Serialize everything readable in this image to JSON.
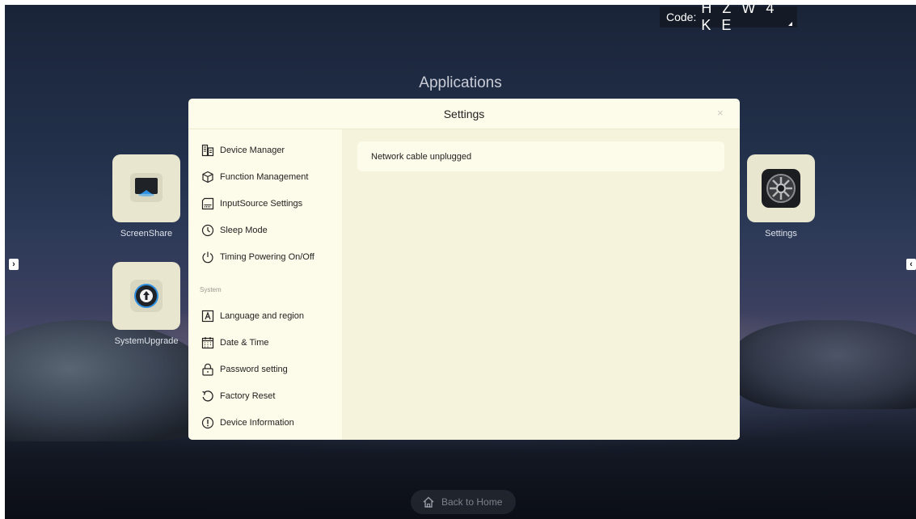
{
  "code": {
    "label": "Code:",
    "value": "H Z W 4 K E"
  },
  "applications_title": "Applications",
  "apps": [
    {
      "label": "ScreenShare",
      "icon": "screenshare-icon"
    },
    {
      "label": "SystemUpgrade",
      "icon": "system-upgrade-icon"
    },
    {
      "label": "Settings",
      "icon": "settings-app-icon"
    }
  ],
  "nav_arrows": {
    "left": "›",
    "right": "‹"
  },
  "back_home": {
    "label": "Back to Home",
    "icon": "home-icon"
  },
  "dialog": {
    "title": "Settings",
    "close": "×",
    "menu": [
      {
        "label": "Device Manager",
        "icon": "device-manager-icon"
      },
      {
        "label": "Function Management",
        "icon": "cube-icon"
      },
      {
        "label": "InputSource Settings",
        "icon": "input-source-icon"
      },
      {
        "label": "Sleep Mode",
        "icon": "clock-icon"
      },
      {
        "label": "Timing Powering On/Off",
        "icon": "power-icon"
      }
    ],
    "section_label": "System",
    "system_menu": [
      {
        "label": "Language and region",
        "icon": "language-icon"
      },
      {
        "label": "Date & Time",
        "icon": "calendar-icon"
      },
      {
        "label": "Password setting",
        "icon": "lock-icon"
      },
      {
        "label": "Factory Reset",
        "icon": "reset-icon"
      },
      {
        "label": "Device Information",
        "icon": "info-icon"
      }
    ],
    "status_message": "Network cable unplugged"
  }
}
